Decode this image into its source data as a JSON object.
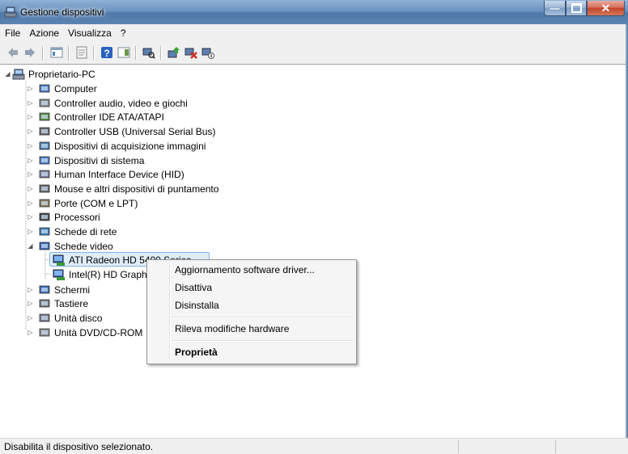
{
  "window": {
    "title": "Gestione dispositivi"
  },
  "menu": [
    "File",
    "Azione",
    "Visualizza",
    "?"
  ],
  "toolbar": {
    "buttons": [
      "back-arrow-icon",
      "forward-arrow-icon",
      "show-hide-tree-icon",
      "properties-icon",
      "help-icon",
      "action-pane-icon",
      "scan-hardware-icon",
      "update-driver-icon",
      "uninstall-icon",
      "disable-icon"
    ]
  },
  "tree": {
    "root": "Proprietario-PC",
    "categories": [
      "Computer",
      "Controller audio, video e giochi",
      "Controller IDE ATA/ATAPI",
      "Controller USB (Universal Serial Bus)",
      "Dispositivi di acquisizione immagini",
      "Dispositivi di sistema",
      "Human Interface Device (HID)",
      "Mouse e altri dispositivi di puntamento",
      "Porte (COM e LPT)",
      "Processori",
      "Schede di rete",
      "Schede video",
      "Schermi",
      "Tastiere",
      "Unità disco",
      "Unità DVD/CD-ROM"
    ],
    "video_children": [
      "ATI Radeon HD 5400 Series",
      "Intel(R) HD Graphics"
    ]
  },
  "context_menu": {
    "items": [
      "Aggiornamento software driver...",
      "Disattiva",
      "Disinstalla",
      "Rileva modifiche hardware",
      "Proprietà"
    ]
  },
  "status": {
    "text": "Disabilita il dispositivo selezionato."
  }
}
